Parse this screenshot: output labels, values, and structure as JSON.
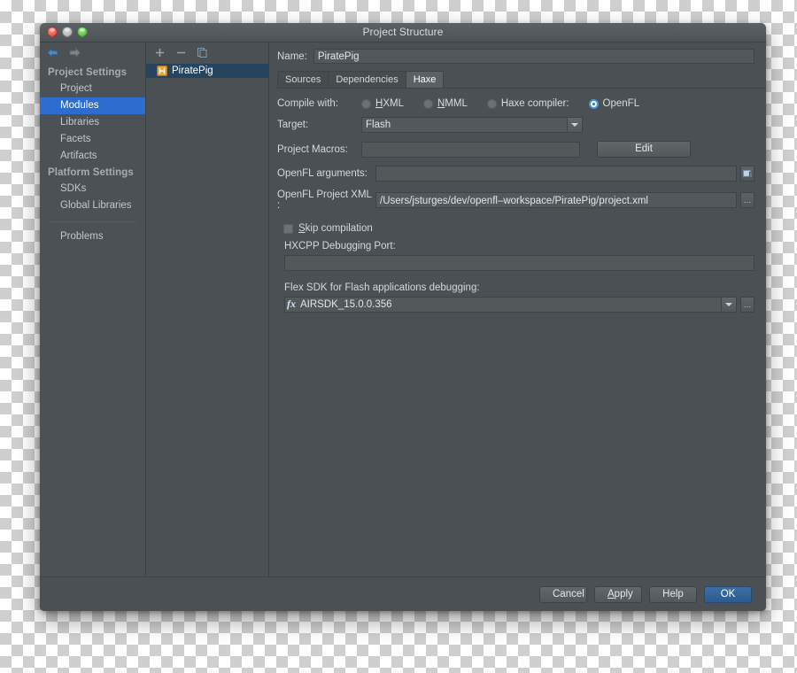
{
  "window": {
    "title": "Project Structure",
    "traffic_lights": [
      "close-button",
      "minimize-button",
      "zoom-button"
    ]
  },
  "nav": {
    "back_icon": "back-arrow-icon",
    "forward_icon": "forward-arrow-icon"
  },
  "sidebar": {
    "groups": [
      {
        "label": "Project Settings",
        "items": [
          {
            "label": "Project",
            "selected": false
          },
          {
            "label": "Modules",
            "selected": true
          },
          {
            "label": "Libraries",
            "selected": false
          },
          {
            "label": "Facets",
            "selected": false
          },
          {
            "label": "Artifacts",
            "selected": false
          }
        ]
      },
      {
        "label": "Platform Settings",
        "items": [
          {
            "label": "SDKs",
            "selected": false
          },
          {
            "label": "Global Libraries",
            "selected": false
          }
        ]
      }
    ],
    "extra_items": [
      {
        "label": "Problems",
        "selected": false
      }
    ]
  },
  "modules_panel": {
    "toolbar": [
      {
        "name": "add-module-button",
        "glyph": "+"
      },
      {
        "name": "remove-module-button",
        "glyph": "−"
      },
      {
        "name": "copy-module-button",
        "glyph": "copy-icon"
      }
    ],
    "items": [
      {
        "label": "PiratePig",
        "selected": true,
        "icon": "haxe-module-icon"
      }
    ]
  },
  "main": {
    "name_label": "Name:",
    "name_value": "PiratePig",
    "tabs": [
      {
        "label": "Sources",
        "active": false
      },
      {
        "label": "Dependencies",
        "active": false
      },
      {
        "label": "Haxe",
        "active": true
      }
    ],
    "compile_with": {
      "label": "Compile with:",
      "options": [
        {
          "label": "HXML",
          "mnemonic": "H",
          "selected": false
        },
        {
          "label": "NMML",
          "mnemonic": "N",
          "selected": false
        },
        {
          "label": "Haxe compiler:",
          "mnemonic": "",
          "selected": false
        },
        {
          "label": "OpenFL",
          "mnemonic": "",
          "selected": true
        }
      ]
    },
    "target": {
      "label": "Target:",
      "value": "Flash"
    },
    "project_macros": {
      "label": "Project Macros:",
      "value": "",
      "edit_button": "Edit"
    },
    "openfl_arguments": {
      "label": "OpenFL arguments:",
      "value": "",
      "expand_icon": "expand-editor-icon"
    },
    "openfl_project_xml": {
      "label": "OpenFL Project XML :",
      "value": "/Users/jsturges/dev/openfl–workspace/PiratePig/project.xml",
      "browse_button": "…"
    },
    "skip_compilation": {
      "label": "Skip compilation",
      "mnemonic": "S",
      "checked": false
    },
    "hxcpp_debugging_port": {
      "label": "HXCPP Debugging Port:",
      "value": ""
    },
    "flex_sdk": {
      "label": "Flex SDK for Flash applications debugging:",
      "value": "AIRSDK_15.0.0.356",
      "icon": "fx-icon",
      "browse_button": "…"
    }
  },
  "footer": {
    "buttons": [
      {
        "label": "Cancel",
        "name": "cancel-button",
        "primary": false,
        "mnemonic": ""
      },
      {
        "label": "Apply",
        "name": "apply-button",
        "primary": false,
        "mnemonic": "A"
      },
      {
        "label": "Help",
        "name": "help-button",
        "primary": false,
        "mnemonic": ""
      },
      {
        "label": "OK",
        "name": "ok-button",
        "primary": true,
        "mnemonic": ""
      }
    ]
  },
  "colors": {
    "window_bg": "#4a5053",
    "selection_blue": "#2f6cd0",
    "module_selection": "#27445f",
    "accent_primary": "#3d6ea3",
    "module_icon_orange": "#e8a33d"
  }
}
